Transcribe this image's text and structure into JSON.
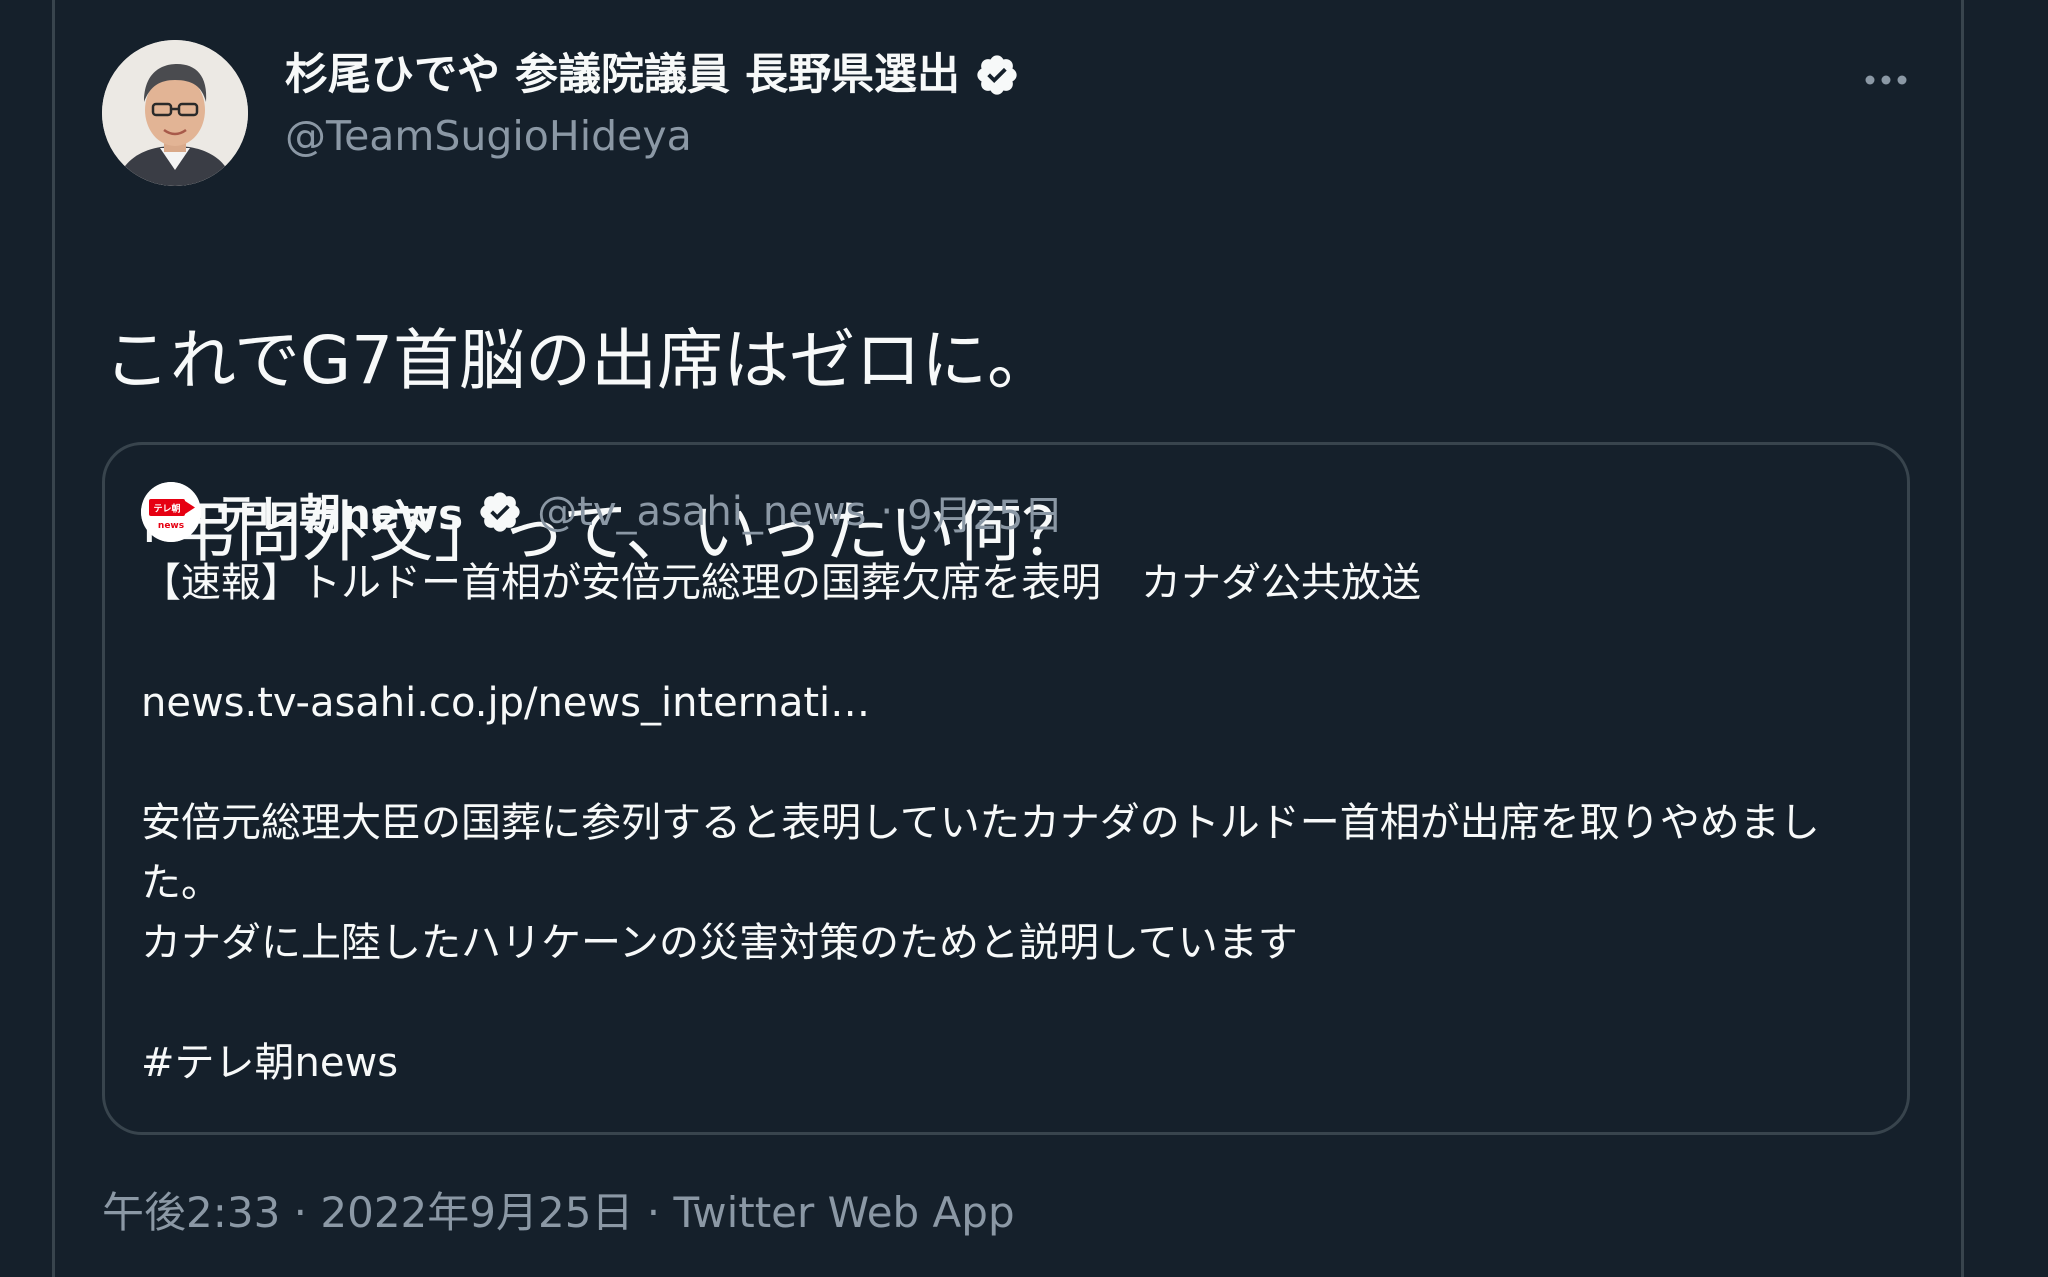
{
  "tweet": {
    "author_name": "杉尾ひでや 参議院議員 長野県選出",
    "author_handle": "@TeamSugioHideya",
    "more_icon": "more-horizontal-icon",
    "text_line1": "これでG7首脳の出席はゼロに。",
    "text_line2": "「弔問外交」って、いったい何？",
    "timestamp": "午後2:33",
    "date": "2022年9月25日",
    "source": "Twitter Web App",
    "separator": " · "
  },
  "quote": {
    "name": "テレ朝news",
    "handle": "@tv_asahi_news",
    "date": "9月25日",
    "separator": " · ",
    "title": "【速報】トルドー首相が安倍元総理の国葬欠席を表明　カナダ公共放送",
    "link": "news.tv-asahi.co.jp/news_internati…",
    "paragraph1": "安倍元総理大臣の国葬に参列すると表明していたカナダのトルドー首相が出席を取りやめました。",
    "paragraph2": "カナダに上陸したハリケーンの災害対策のためと説明しています",
    "hashtag": "#テレ朝news",
    "logo_text_top": "テレ朝",
    "logo_text_bottom": "news"
  },
  "colors": {
    "background": "#15202b",
    "text_primary": "#f7f9f9",
    "text_secondary": "#8b98a5",
    "border": "#38444d",
    "logo_red": "#e60012"
  }
}
